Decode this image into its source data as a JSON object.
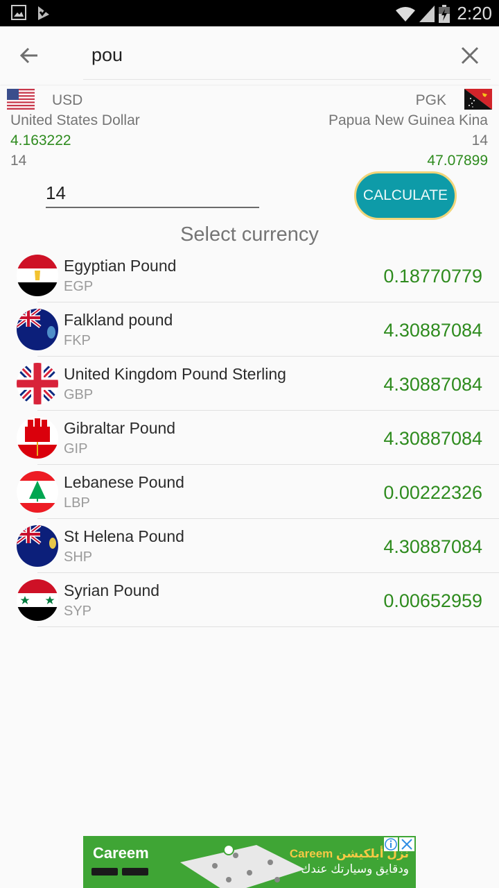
{
  "status_bar": {
    "time": "2:20",
    "left_icons": [
      "image-icon",
      "task-check-icon"
    ],
    "right_icons": [
      "wifi-icon",
      "signal-icon",
      "battery-charging-icon"
    ]
  },
  "search": {
    "query": "pou",
    "back_icon": "arrow-left-icon",
    "clear_icon": "close-icon"
  },
  "converter": {
    "from": {
      "code": "USD",
      "name": "United States Dollar",
      "rate": "4.163222",
      "amount": "14",
      "flag": "us-flag-icon"
    },
    "to": {
      "code": "PGK",
      "name": "Papua New Guinea Kina",
      "amount": "14",
      "result": "47.07899",
      "flag": "png-flag-icon"
    },
    "amount_input": "14",
    "calculate_label": "CALCULATE"
  },
  "list": {
    "title": "Select currency",
    "items": [
      {
        "name": "Egyptian Pound",
        "code": "EGP",
        "value": "0.18770779",
        "flag": "egypt-flag-icon"
      },
      {
        "name": "Falkland pound",
        "code": "FKP",
        "value": "4.30887084",
        "flag": "falkland-flag-icon"
      },
      {
        "name": "United Kingdom Pound Sterling",
        "code": "GBP",
        "value": "4.30887084",
        "flag": "uk-flag-icon"
      },
      {
        "name": "Gibraltar Pound",
        "code": "GIP",
        "value": "4.30887084",
        "flag": "gibraltar-flag-icon"
      },
      {
        "name": "Lebanese Pound",
        "code": "LBP",
        "value": "0.00222326",
        "flag": "lebanon-flag-icon"
      },
      {
        "name": "St Helena Pound",
        "code": "SHP",
        "value": "4.30887084",
        "flag": "st-helena-flag-icon"
      },
      {
        "name": "Syrian Pound",
        "code": "SYP",
        "value": "0.00652959",
        "flag": "syria-flag-icon"
      }
    ]
  },
  "ad": {
    "brand": "Careem",
    "headline": "نزل أبلكيشن Careem",
    "subline": "ودقايق وسيارتك عندك",
    "info_icon": "info-icon",
    "close_icon": "close-icon"
  },
  "colors": {
    "accent_green": "#2e8b1e",
    "button_teal": "#0e9ba8",
    "button_border": "#f0d57a",
    "caret_red": "#d32f2f",
    "ad_green": "#3fa535"
  }
}
